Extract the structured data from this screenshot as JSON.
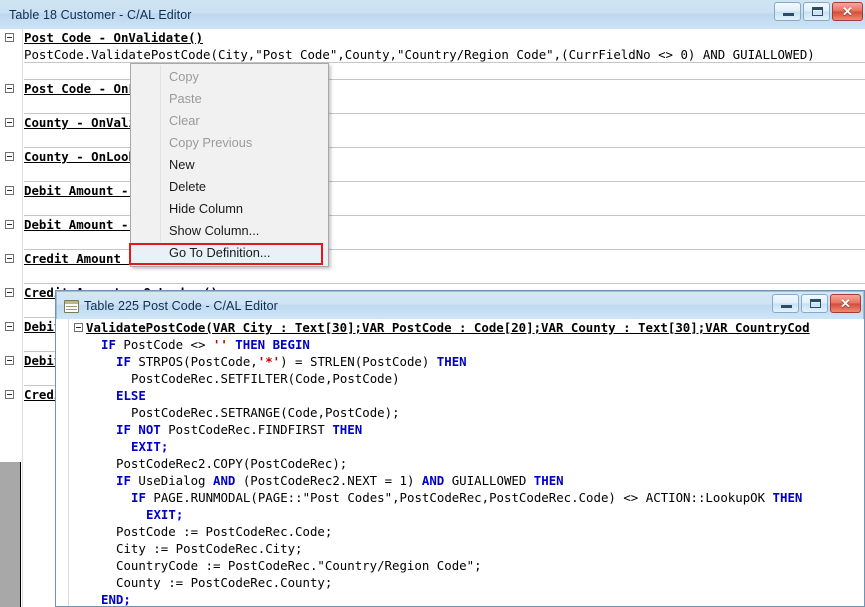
{
  "window1": {
    "title": "Table 18 Customer - C/AL Editor",
    "icon": "table-icon",
    "controls": {
      "minimize": "minimize-icon",
      "maximize": "maximize-icon",
      "close": "close-icon",
      "close_glyph": "✕"
    },
    "lines": [
      {
        "type": "header",
        "text": "Post Code - OnValidate()"
      },
      {
        "type": "code",
        "text": "PostCode.ValidatePostCode(City,\"Post Code\",County,\"Country/Region Code\",(CurrFieldNo <> 0) AND GUIALLOWED)"
      },
      {
        "type": "blank",
        "text": ""
      },
      {
        "type": "header",
        "text": "Post Code - OnLookup()"
      },
      {
        "type": "blank",
        "text": ""
      },
      {
        "type": "header",
        "text": "County - OnValidate()"
      },
      {
        "type": "blank",
        "text": ""
      },
      {
        "type": "header",
        "text": "County - OnLookup()"
      },
      {
        "type": "blank",
        "text": ""
      },
      {
        "type": "header",
        "text": "Debit Amount - OnValidate()"
      },
      {
        "type": "blank",
        "text": ""
      },
      {
        "type": "header",
        "text": "Debit Amount - OnLookup()"
      },
      {
        "type": "blank",
        "text": ""
      },
      {
        "type": "header",
        "text": "Credit Amount - OnValidate()"
      },
      {
        "type": "blank",
        "text": ""
      },
      {
        "type": "header",
        "text": "Credit Amount - OnLookup()"
      },
      {
        "type": "blank",
        "text": ""
      },
      {
        "type": "header",
        "text": "Debit Amount (LCY) - OnValidate()"
      },
      {
        "type": "blank",
        "text": ""
      },
      {
        "type": "header",
        "text": "Debit Amount (LCY) - OnLookup()"
      },
      {
        "type": "blank",
        "text": ""
      },
      {
        "type": "header",
        "text": "Credit Amount (LCY) - OnValidate()"
      }
    ]
  },
  "context_menu": {
    "items": [
      {
        "label": "Copy",
        "enabled": false,
        "selected": false
      },
      {
        "label": "Paste",
        "enabled": false,
        "selected": false
      },
      {
        "label": "Clear",
        "enabled": false,
        "selected": false
      },
      {
        "label": "Copy Previous",
        "enabled": false,
        "selected": false
      },
      {
        "label": "New",
        "enabled": true,
        "selected": false
      },
      {
        "label": "Delete",
        "enabled": true,
        "selected": false
      },
      {
        "label": "Hide Column",
        "enabled": true,
        "selected": false
      },
      {
        "label": "Show Column...",
        "enabled": true,
        "selected": false
      },
      {
        "label": "Go To Definition...",
        "enabled": true,
        "selected": true
      }
    ],
    "highlight_color": "#e01b17"
  },
  "window2": {
    "title": "Table 225 Post Code - C/AL Editor",
    "icon": "table-icon",
    "controls": {
      "minimize": "minimize-icon",
      "maximize": "maximize-icon",
      "close": "close-icon",
      "close_glyph": "✕"
    },
    "lines": [
      {
        "indent": 0,
        "header": true,
        "tokens": [
          {
            "t": "ValidatePostCode(VAR City : Text[30];VAR PostCode : Code[20];VAR County : Text[30];VAR CountryCod",
            "c": "plain"
          }
        ]
      },
      {
        "indent": 1,
        "header": false,
        "tokens": [
          {
            "t": "IF",
            "c": "kw"
          },
          {
            "t": " PostCode <> ",
            "c": "plain"
          },
          {
            "t": "''",
            "c": "st"
          },
          {
            "t": " ",
            "c": "plain"
          },
          {
            "t": "THEN BEGIN",
            "c": "kw"
          }
        ]
      },
      {
        "indent": 2,
        "header": false,
        "tokens": [
          {
            "t": "IF",
            "c": "kw"
          },
          {
            "t": " STRPOS(PostCode,",
            "c": "plain"
          },
          {
            "t": "'*'",
            "c": "st"
          },
          {
            "t": ") = STRLEN(PostCode) ",
            "c": "plain"
          },
          {
            "t": "THEN",
            "c": "kw"
          }
        ]
      },
      {
        "indent": 3,
        "header": false,
        "tokens": [
          {
            "t": "PostCodeRec.SETFILTER(Code,PostCode)",
            "c": "plain"
          }
        ]
      },
      {
        "indent": 2,
        "header": false,
        "tokens": [
          {
            "t": "ELSE",
            "c": "kw"
          }
        ]
      },
      {
        "indent": 3,
        "header": false,
        "tokens": [
          {
            "t": "PostCodeRec.SETRANGE(Code,PostCode);",
            "c": "plain"
          }
        ]
      },
      {
        "indent": 2,
        "header": false,
        "tokens": [
          {
            "t": "IF NOT",
            "c": "kw"
          },
          {
            "t": " PostCodeRec.FINDFIRST ",
            "c": "plain"
          },
          {
            "t": "THEN",
            "c": "kw"
          }
        ]
      },
      {
        "indent": 3,
        "header": false,
        "tokens": [
          {
            "t": "EXIT;",
            "c": "kw"
          }
        ]
      },
      {
        "indent": 2,
        "header": false,
        "tokens": [
          {
            "t": "PostCodeRec2.COPY(PostCodeRec);",
            "c": "plain"
          }
        ]
      },
      {
        "indent": 2,
        "header": false,
        "tokens": [
          {
            "t": "IF",
            "c": "kw"
          },
          {
            "t": " UseDialog ",
            "c": "plain"
          },
          {
            "t": "AND",
            "c": "kw"
          },
          {
            "t": " (PostCodeRec2.NEXT = 1) ",
            "c": "plain"
          },
          {
            "t": "AND",
            "c": "kw"
          },
          {
            "t": " GUIALLOWED ",
            "c": "plain"
          },
          {
            "t": "THEN",
            "c": "kw"
          }
        ]
      },
      {
        "indent": 3,
        "header": false,
        "tokens": [
          {
            "t": "IF",
            "c": "kw"
          },
          {
            "t": " PAGE.RUNMODAL(PAGE::\"Post Codes\",PostCodeRec,PostCodeRec.Code) <> ACTION::LookupOK ",
            "c": "plain"
          },
          {
            "t": "THEN",
            "c": "kw"
          }
        ]
      },
      {
        "indent": 4,
        "header": false,
        "tokens": [
          {
            "t": "EXIT;",
            "c": "kw"
          }
        ]
      },
      {
        "indent": 2,
        "header": false,
        "tokens": [
          {
            "t": "PostCode := PostCodeRec.Code;",
            "c": "plain"
          }
        ]
      },
      {
        "indent": 2,
        "header": false,
        "tokens": [
          {
            "t": "City := PostCodeRec.City;",
            "c": "plain"
          }
        ]
      },
      {
        "indent": 2,
        "header": false,
        "tokens": [
          {
            "t": "CountryCode := PostCodeRec.\"Country/Region Code\";",
            "c": "plain"
          }
        ]
      },
      {
        "indent": 2,
        "header": false,
        "tokens": [
          {
            "t": "County := PostCodeRec.County;",
            "c": "plain"
          }
        ]
      },
      {
        "indent": 1,
        "header": false,
        "tokens": [
          {
            "t": "END;",
            "c": "kw"
          }
        ]
      }
    ]
  },
  "colors": {
    "keyword": "#0000c8",
    "string": "#c00000",
    "titlebar": "#cfe4f3",
    "highlight": "#e01b17"
  }
}
